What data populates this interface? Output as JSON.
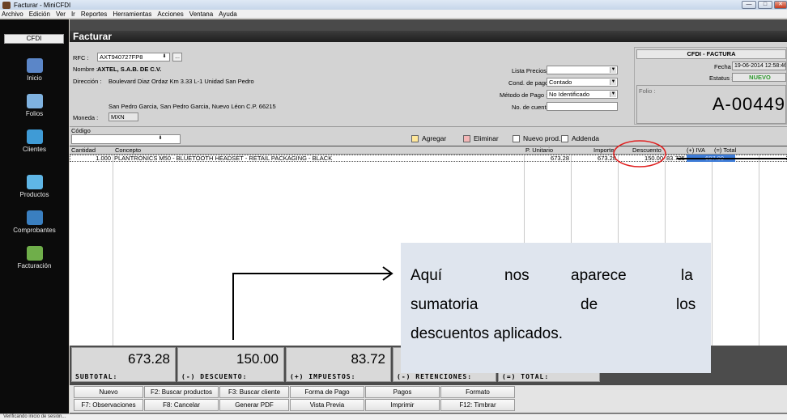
{
  "window": {
    "title": "Facturar - MiniCFDI",
    "minimize": "—",
    "maximize": "□",
    "close": "✕"
  },
  "menu": [
    "Archivo",
    "Edición",
    "Ver",
    "Ir",
    "Reportes",
    "Herramientas",
    "Acciones",
    "Ventana",
    "Ayuda"
  ],
  "sidebar": {
    "tab": "CFDI",
    "items": [
      {
        "label": "Inicio",
        "icon": "home-icon",
        "color": "#5b86c8"
      },
      {
        "label": "Folios",
        "icon": "barcode-icon",
        "color": "#7fb2e0"
      },
      {
        "label": "Clientes",
        "icon": "clients-icon",
        "color": "#3f9bd6"
      },
      {
        "label": "Productos",
        "icon": "products-icon",
        "color": "#5fb6e6"
      },
      {
        "label": "Comprobantes",
        "icon": "documents-icon",
        "color": "#3a7fc0"
      },
      {
        "label": "Facturación",
        "icon": "invoice-icon",
        "color": "#6fae4a"
      }
    ]
  },
  "header": {
    "title": "Facturar"
  },
  "customer": {
    "rfc_label": "RFC :",
    "rfc_value": "AXT940727FP8",
    "rfc_btn": "...",
    "nombre_label": "Nombre :",
    "nombre_value": "AXTEL, S.A.B. DE C.V.",
    "direccion_label": "Dirección :",
    "direccion_value": "Boulevard Diaz Ordaz Km 3.33 L-1 Unidad San Pedro",
    "direccion_value2": "San Pedro Garcia, San Pedro Garcia, Nuevo Léon C.P. 66215",
    "moneda_label": "Moneda :",
    "moneda_value": "MXN"
  },
  "payment": {
    "lista_label": "Lista Precios :",
    "lista_value": "",
    "cond_label": "Cond. de pago :",
    "cond_value": "Contado",
    "metodo_label": "Método de Pago :",
    "metodo_value": "No Identificado",
    "cuenta_label": "No. de cuenta :",
    "cuenta_value": ""
  },
  "cfdi": {
    "heading": "CFDI - FACTURA",
    "fecha_label": "Fecha :",
    "fecha_value": "19-06-2014 12:58:46",
    "estatus_label": "Estatus :",
    "estatus_value": "NUEVO",
    "folio_label": "Folio :",
    "folio_value": "A-00449",
    "estatus_color": "#2e9a2e"
  },
  "code": {
    "label": "Código",
    "value": ""
  },
  "toolbar": {
    "agregar": "Agregar",
    "eliminar": "Eliminar",
    "nuevo_prod": "Nuevo prod.",
    "addenda": "Addenda"
  },
  "grid": {
    "columns": [
      "Cantidad",
      "Concepto",
      "P. Unitario",
      "Importe",
      "Descuento",
      "(+) IVA",
      "(=) Total"
    ],
    "rows": [
      {
        "cantidad": "1.000",
        "concepto": "PLANTRONICS M50 - BLUETOOTH HEADSET - RETAIL PACKAGING - BLACK",
        "p_unitario": "673.28",
        "importe": "673.28",
        "descuento": "150.00",
        "iva": "83.725",
        "total": "607.00"
      }
    ]
  },
  "annotation": {
    "line1a": "Aquí",
    "line1b": "nos",
    "line1c": "aparece",
    "line1d": "la",
    "line2a": "sumatoria",
    "line2b": "de",
    "line2c": "los",
    "line3": "descuentos aplicados."
  },
  "summary": {
    "subtotal_value": "673.28",
    "subtotal_label": "SUBTOTAL:",
    "descuento_value": "150.00",
    "descuento_label": "(-) DESCUENTO:",
    "impuestos_value": "83.72",
    "impuestos_label": "(+) IMPUESTOS:",
    "retenciones_label": "(-) RETENCIONES:",
    "total_label": "(=) TOTAL:"
  },
  "fnkeys": {
    "row1": [
      "Nuevo",
      "F2: Buscar productos",
      "F3: Buscar cliente",
      "Forma de Pago",
      "Pagos",
      "Formato"
    ],
    "row2": [
      "F7: Observaciones",
      "F8: Cancelar",
      "Generar PDF",
      "Vista Previa",
      "Imprimir",
      "F12: Timbrar"
    ]
  },
  "status": {
    "text": "Verificando inicio de sesión..."
  }
}
